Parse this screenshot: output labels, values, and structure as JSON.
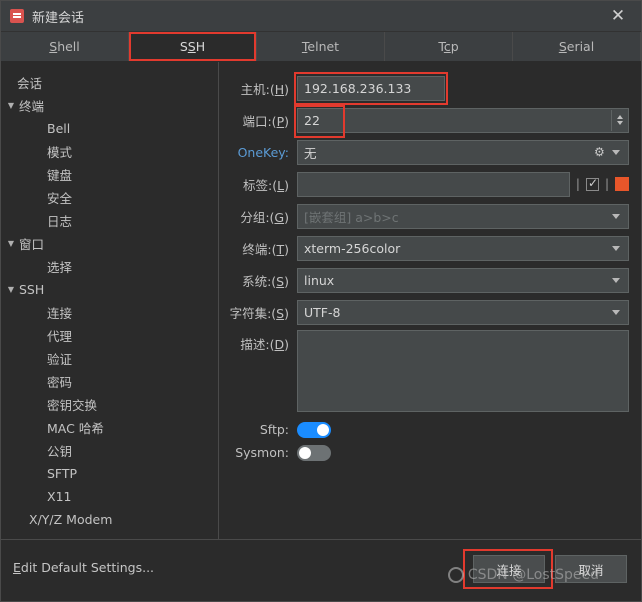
{
  "window": {
    "title": "新建会话",
    "close_label": "✕",
    "app_icon": "terminal-icon"
  },
  "tabs": [
    {
      "label": "Shell",
      "accel": "S",
      "selected": false
    },
    {
      "label": "SSH",
      "accel": "S",
      "selected": true,
      "highlighted": true
    },
    {
      "label": "Telnet",
      "accel": "T",
      "selected": false
    },
    {
      "label": "Tcp",
      "accel": "T",
      "selected": false
    },
    {
      "label": "Serial",
      "accel": "S",
      "selected": false
    }
  ],
  "sidebar": {
    "items": [
      {
        "label": "会话",
        "indent": 1,
        "arrow": ""
      },
      {
        "label": "终端",
        "indent": 0,
        "arrow": "▼"
      },
      {
        "label": "Bell",
        "indent": 2,
        "arrow": ""
      },
      {
        "label": "模式",
        "indent": 2,
        "arrow": ""
      },
      {
        "label": "键盘",
        "indent": 2,
        "arrow": ""
      },
      {
        "label": "安全",
        "indent": 2,
        "arrow": ""
      },
      {
        "label": "日志",
        "indent": 2,
        "arrow": ""
      },
      {
        "label": "窗口",
        "indent": 0,
        "arrow": "▼"
      },
      {
        "label": "选择",
        "indent": 2,
        "arrow": ""
      },
      {
        "label": "SSH",
        "indent": 0,
        "arrow": "▼"
      },
      {
        "label": "连接",
        "indent": 2,
        "arrow": ""
      },
      {
        "label": "代理",
        "indent": 2,
        "arrow": ""
      },
      {
        "label": "验证",
        "indent": 2,
        "arrow": ""
      },
      {
        "label": "密码",
        "indent": 2,
        "arrow": ""
      },
      {
        "label": "密钥交换",
        "indent": 2,
        "arrow": ""
      },
      {
        "label": "MAC 哈希",
        "indent": 2,
        "arrow": ""
      },
      {
        "label": "公钥",
        "indent": 2,
        "arrow": ""
      },
      {
        "label": "SFTP",
        "indent": 2,
        "arrow": ""
      },
      {
        "label": "X11",
        "indent": 2,
        "arrow": ""
      },
      {
        "label": "X/Y/Z Modem",
        "indent": 1,
        "arrow": ""
      }
    ]
  },
  "form": {
    "host": {
      "label": "主机:(H)",
      "value": "192.168.236.133",
      "highlighted": true
    },
    "port": {
      "label": "端口:(P)",
      "value": "22",
      "highlighted": true
    },
    "onekey": {
      "label": "OneKey:",
      "value": "无"
    },
    "tag": {
      "label": "标签:(L)",
      "value": "",
      "placeholder": "",
      "separator": "|",
      "color": "#e8562a"
    },
    "group": {
      "label": "分组:(G)",
      "value": "[嵌套组] a>b>c"
    },
    "terminal": {
      "label": "终端:(T)",
      "value": "xterm-256color"
    },
    "system": {
      "label": "系统:(S)",
      "value": "linux"
    },
    "charset": {
      "label": "字符集:(S)",
      "value": "UTF-8"
    },
    "description": {
      "label": "描述:(D)",
      "value": ""
    },
    "sftp": {
      "label": "Sftp:",
      "state": "on"
    },
    "sysmon": {
      "label": "Sysmon:",
      "state": "off"
    }
  },
  "footer": {
    "edit_defaults": "Edit Default Settings...",
    "connect": "连接",
    "cancel": "取消"
  },
  "watermark": "CSDN @LostSpeed"
}
